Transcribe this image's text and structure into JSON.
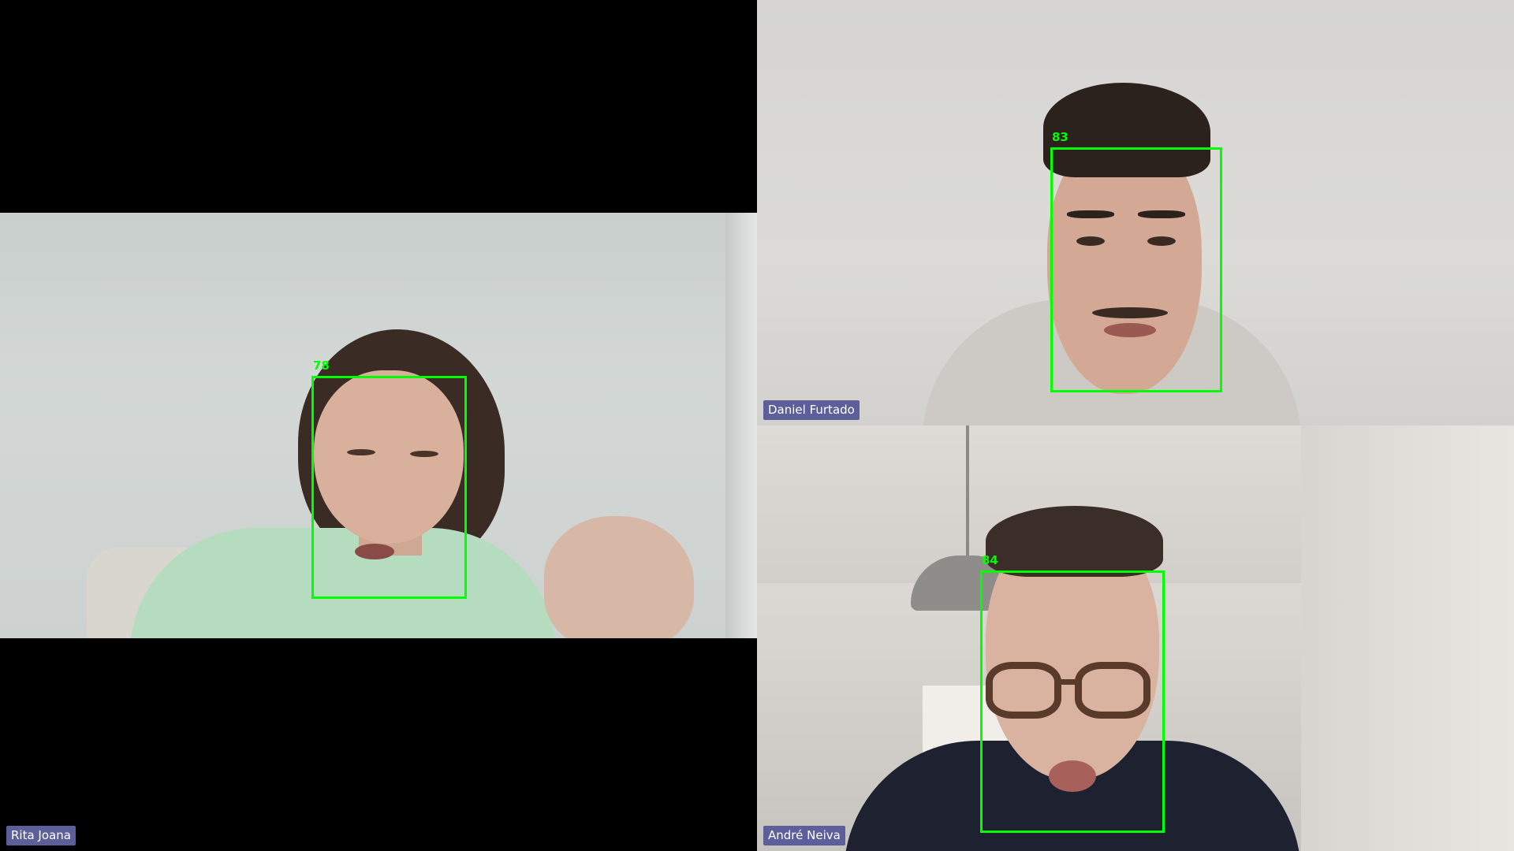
{
  "participants": [
    {
      "name": "Rita Joana",
      "face_score": "78"
    },
    {
      "name": "Daniel Furtado",
      "face_score": "83"
    },
    {
      "name": "André Neiva",
      "face_score": "84"
    }
  ],
  "colors": {
    "name_tag_bg": "#5c5f9a",
    "face_box": "#00ff00",
    "background": "#000000"
  }
}
